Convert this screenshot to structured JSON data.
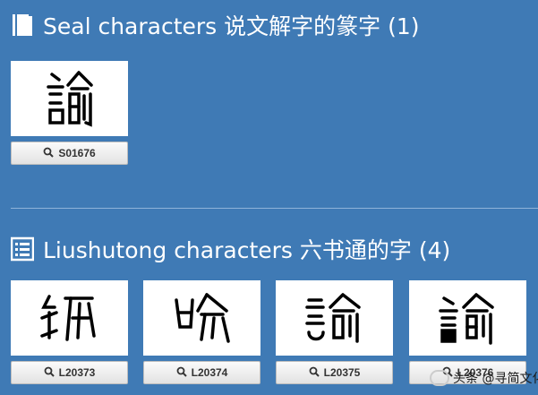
{
  "colors": {
    "background": "#3f7ab5",
    "header_text": "#ffffff",
    "button_bg": "#e9e9e9"
  },
  "seal": {
    "title": "Seal characters 说文解字的篆字 (1)",
    "icon": "book-icon",
    "items": [
      {
        "id": "S01676"
      }
    ]
  },
  "liushutong": {
    "title": "Liushutong characters 六书通的字 (4)",
    "icon": "list-icon",
    "items": [
      {
        "id": "L20373"
      },
      {
        "id": "L20374"
      },
      {
        "id": "L20375"
      },
      {
        "id": "L20376"
      }
    ]
  },
  "watermark": {
    "text": "头条 @寻简文化"
  }
}
